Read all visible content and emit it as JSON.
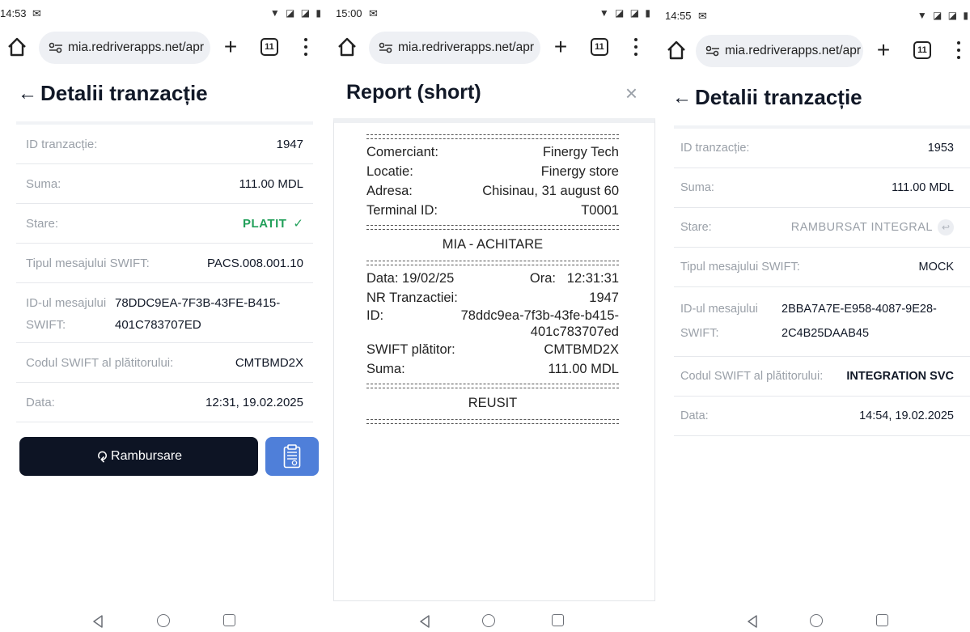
{
  "browser": {
    "url": "mia.redriverapps.net/apr",
    "tab_count": "11"
  },
  "colors": {
    "dark_button": "#0d1424",
    "report_button": "#4f7fd9",
    "paid_green": "#22a05a"
  },
  "screens": [
    {
      "status_time": "14:53",
      "title": "Detalii tranzacție",
      "rows": {
        "id_label": "ID tranzacție:",
        "id_value": "1947",
        "sum_label": "Suma:",
        "sum_value": "111.00 MDL",
        "state_label": "Stare:",
        "state_value": "PLATIT",
        "swift_type_label": "Tipul mesajului SWIFT:",
        "swift_type_value": "PACS.008.001.10",
        "swift_id_label_1": "ID-ul mesajului",
        "swift_id_label_2": "SWIFT:",
        "swift_id_value_1": "78DDC9EA-7F3B-43FE-B415-",
        "swift_id_value_2": "401C783707ED",
        "payer_label": "Codul SWIFT al plătitorului:",
        "payer_value": "CMTBMD2X",
        "date_label": "Data:",
        "date_value": "12:31, 19.02.2025"
      },
      "refund_button": "Rambursare"
    },
    {
      "status_time": "15:00",
      "title": "Report (short)",
      "receipt": {
        "merchant_label": "Comerciant:",
        "merchant_value": "Finergy Tech",
        "location_label": "Locatie:",
        "location_value": "Finergy store",
        "address_label": "Adresa:",
        "address_value": "Chisinau, 31 august 60",
        "terminal_label": "Terminal ID:",
        "terminal_value": "T0001",
        "heading": "MIA - ACHITARE",
        "date_label": "Data:",
        "date_value": "19/02/25",
        "time_label": "Ora:",
        "time_value": "12:31:31",
        "nr_label": "NR Tranzactiei:",
        "nr_value": "1947",
        "id_label": "ID:",
        "id_value_1": "78ddc9ea-7f3b-43fe-b415-",
        "id_value_2": "401c783707ed",
        "swift_label": "SWIFT plătitor:",
        "swift_value": "CMTBMD2X",
        "sum_label": "Suma:",
        "sum_value": "111.00 MDL",
        "result": "REUSIT"
      }
    },
    {
      "status_time": "14:55",
      "title": "Detalii tranzacție",
      "rows": {
        "id_label": "ID tranzacție:",
        "id_value": "1953",
        "sum_label": "Suma:",
        "sum_value": "111.00 MDL",
        "state_label": "Stare:",
        "state_value": "RAMBURSAT INTEGRAL",
        "swift_type_label": "Tipul mesajului SWIFT:",
        "swift_type_value": "MOCK",
        "swift_id_label_1": "ID-ul mesajului",
        "swift_id_label_2": "SWIFT:",
        "swift_id_value_1": "2BBA7A7E-E958-4087-9E28-",
        "swift_id_value_2": "2C4B25DAAB45",
        "payer_label": "Codul SWIFT al plătitorului:",
        "payer_value": "INTEGRATION SVC",
        "date_label": "Data:",
        "date_value": "14:54, 19.02.2025"
      }
    }
  ]
}
